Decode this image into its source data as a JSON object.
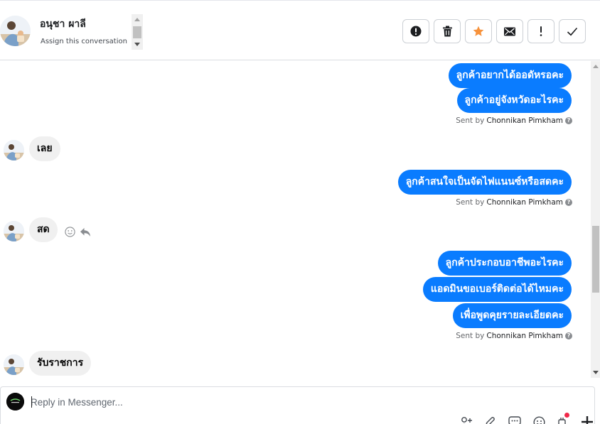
{
  "header": {
    "contact_name": "อนุชา ผาลี",
    "assign_label": "Assign this conversation"
  },
  "actions": [
    {
      "name": "report-button",
      "icon": "exclamation-circle-icon"
    },
    {
      "name": "delete-button",
      "icon": "trash-icon"
    },
    {
      "name": "star-button",
      "icon": "star-icon",
      "color": "#f7923b"
    },
    {
      "name": "mark-unread-button",
      "icon": "envelope-icon"
    },
    {
      "name": "follow-up-button",
      "icon": "exclamation-icon"
    },
    {
      "name": "mark-done-button",
      "icon": "check-icon"
    }
  ],
  "messages": {
    "out_1": "ลูกค้าอยากได้ออดัหรอคะ",
    "out_2": "ลูกค้าอยู่จังหวัดอะไรคะ",
    "sent_by_1_prefix": "Sent by",
    "sent_by_1_name": "Chonnikan Pimkham",
    "in_1": "เลย",
    "out_3": "ลูกค้าสนใจเป็นจัดไฟแนนซ์หรือสดคะ",
    "sent_by_2_prefix": "Sent by",
    "sent_by_2_name": "Chonnikan Pimkham",
    "in_2": "สด",
    "out_4": "ลูกค้าประกอบอาชีพอะไรคะ",
    "out_5": "แอดมินขอเบอร์ติดต่อได้ไหมคะ",
    "out_6": "เพื่อพูดคุยรายละเอียดคะ",
    "sent_by_3_prefix": "Sent by",
    "sent_by_3_name": "Chonnikan Pimkham",
    "in_3": "รับราชการ"
  },
  "composer": {
    "placeholder": "Reply in Messenger..."
  },
  "colors": {
    "outgoing_bubble": "#0a7cff",
    "incoming_bubble": "#f0f0f0",
    "notification_dot": "#f02849"
  }
}
